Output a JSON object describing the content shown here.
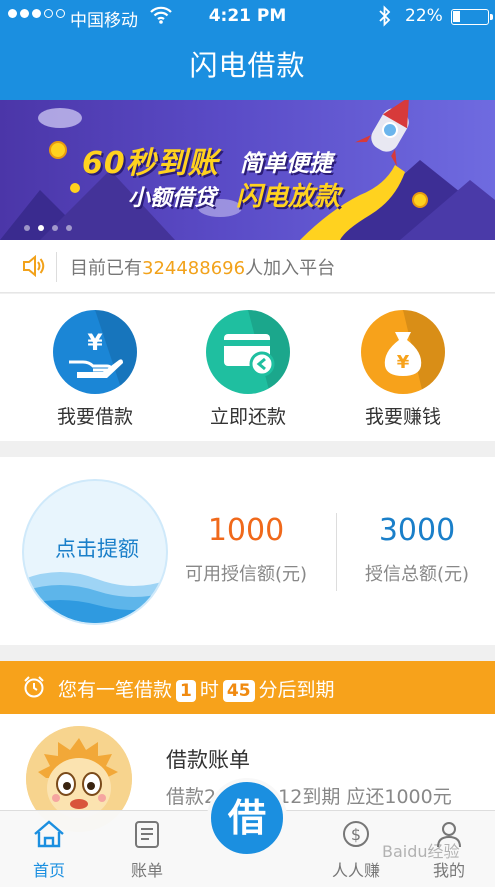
{
  "status_bar": {
    "carrier": "中国移动",
    "time": "4:21 PM",
    "battery": "22%",
    "battery_level": 0.22
  },
  "nav": {
    "title": "闪电借款"
  },
  "banner": {
    "line1_highlight": "60秒到账",
    "line1_text": "简单便捷",
    "line2_text": "小额借贷",
    "line2_highlight": "闪电放款",
    "slide_count": 4,
    "active_slide": 2
  },
  "notice": {
    "prefix": "目前已有",
    "count": "324488696",
    "suffix": "人加入平台"
  },
  "actions": [
    {
      "label": "我要借款",
      "icon": "hand-yen-icon",
      "color": "#1b86d6"
    },
    {
      "label": "立即还款",
      "icon": "card-return-icon",
      "color": "#1fbfa0"
    },
    {
      "label": "我要赚钱",
      "icon": "money-bag-icon",
      "color": "#f7a21b"
    }
  ],
  "credit": {
    "button_label": "点击提额",
    "available_value": "1000",
    "available_label": "可用授信额(元)",
    "total_value": "3000",
    "total_label": "授信总额(元)",
    "available_color": "#f0691b",
    "total_color": "#1a7fc9"
  },
  "due_alert": {
    "prefix": "您有一笔借款",
    "hours": "1",
    "hours_unit": "时",
    "minutes": "45",
    "suffix": "分后到期"
  },
  "bill": {
    "title": "借款账单",
    "detail": "借款2015-8-12到期  应还1000元"
  },
  "tabs": [
    {
      "label": "首页",
      "icon": "home-icon",
      "active": true
    },
    {
      "label": "账单",
      "icon": "bill-icon",
      "active": false
    },
    {
      "label": "借",
      "icon": "borrow-icon",
      "active": false
    },
    {
      "label": "人人赚",
      "icon": "dollar-coin-icon",
      "active": false
    },
    {
      "label": "我的",
      "icon": "user-icon",
      "active": false
    }
  ],
  "watermark": "Baidu经验",
  "colors": {
    "brand_blue": "#1b8fe0",
    "alert_orange": "#f7a21b",
    "highlight_yellow": "#ffd21f"
  }
}
